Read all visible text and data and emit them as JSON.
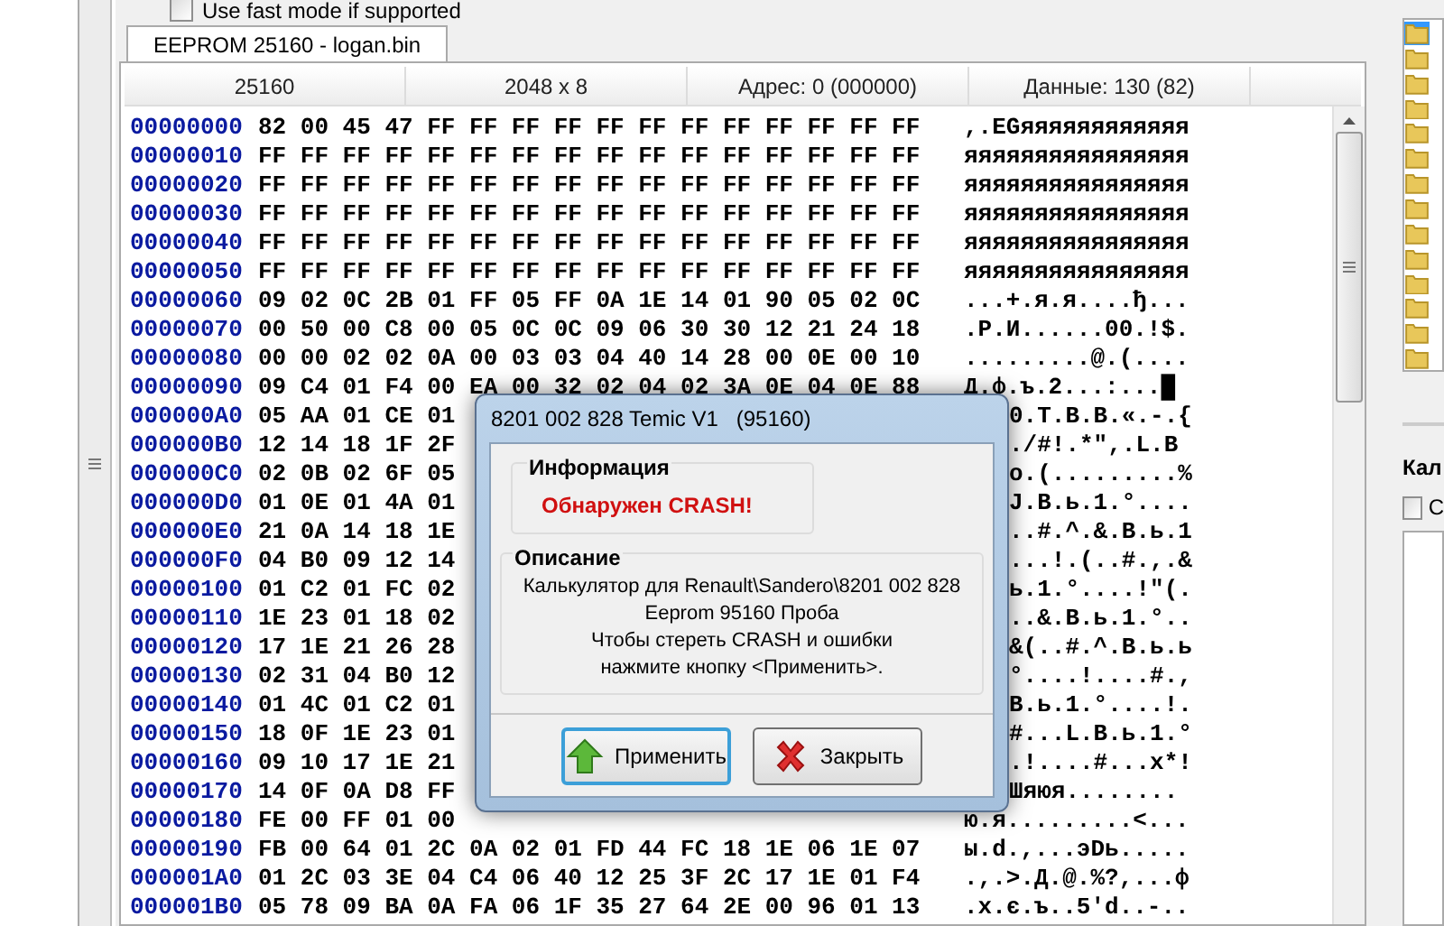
{
  "options": {
    "fast_mode": {
      "label": "Use fast mode if supported",
      "checked": false
    }
  },
  "tab": {
    "label": "EEPROM 25160 - logan.bin",
    "selected": true
  },
  "info_bar": [
    "25160",
    "2048 x 8",
    "Адрес: 0 (000000)",
    "Данные: 130 (82)"
  ],
  "hex_rows": [
    {
      "address": "00000000",
      "bytes": "82 00 45 47 FF FF FF FF FF FF FF FF FF FF FF FF",
      "ascii": ",.EGяяяяяяяяяяяя"
    },
    {
      "address": "00000010",
      "bytes": "FF FF FF FF FF FF FF FF FF FF FF FF FF FF FF FF",
      "ascii": "яяяяяяяяяяяяяяяя"
    },
    {
      "address": "00000020",
      "bytes": "FF FF FF FF FF FF FF FF FF FF FF FF FF FF FF FF",
      "ascii": "яяяяяяяяяяяяяяяя"
    },
    {
      "address": "00000030",
      "bytes": "FF FF FF FF FF FF FF FF FF FF FF FF FF FF FF FF",
      "ascii": "яяяяяяяяяяяяяяяя"
    },
    {
      "address": "00000040",
      "bytes": "FF FF FF FF FF FF FF FF FF FF FF FF FF FF FF FF",
      "ascii": "яяяяяяяяяяяяяяяя"
    },
    {
      "address": "00000050",
      "bytes": "FF FF FF FF FF FF FF FF FF FF FF FF FF FF FF FF",
      "ascii": "яяяяяяяяяяяяяяяя"
    },
    {
      "address": "00000060",
      "bytes": "09 02 0C 2B 01 FF 05 FF 0A 1E 14 01 90 05 02 0C",
      "ascii": "...+.я.я....ђ..."
    },
    {
      "address": "00000070",
      "bytes": "00 50 00 C8 00 05 0C 0C 09 06 30 30 12 21 24 18",
      "ascii": ".P.И......00.!$."
    },
    {
      "address": "00000080",
      "bytes": "00 00 02 02 0A 00 03 03 04 40 14 28 00 0E 00 10",
      "ascii": ".........@.(...."
    },
    {
      "address": "00000090",
      "bytes": "09 C4 01 F4 00 EA 00 32 02 04 02 3A 0E 04 0E 88",
      "ascii": "Д.ф.ъ.2...:...█"
    },
    {
      "address": "000000A0",
      "bytes": "05 AA 01 CE 01",
      "kind": "partly_hidden",
      "ascii": "0.T.B.B.«.-.{"
    },
    {
      "address": "000000B0",
      "bytes": "12 14 18 1F 2F",
      "kind": "partly_hidden",
      "ascii": "./#!.*\",.L.B"
    },
    {
      "address": "000000C0",
      "bytes": "02 0B 02 6F 05",
      "kind": "partly_hidden",
      "ascii": "o.(.........%"
    },
    {
      "address": "000000D0",
      "bytes": "01 0E 01 4A 01",
      "kind": "partly_hidden",
      "ascii": "J.B.ь.1.°...."
    },
    {
      "address": "000000E0",
      "bytes": "21 0A 14 18 1E",
      "kind": "partly_hidden",
      "ascii": "..#.^.&.B.ь.1"
    },
    {
      "address": "000000F0",
      "bytes": "04 B0 09 12 14",
      "kind": "partly_hidden",
      "ascii": "...!.(..#.,.&"
    },
    {
      "address": "00000100",
      "bytes": "01 C2 01 FC 02",
      "kind": "partly_hidden",
      "ascii": "ь.1.°....!\"(."
    },
    {
      "address": "00000110",
      "bytes": "1E 23 01 18 02",
      "kind": "partly_hidden",
      "ascii": "..&.B.ь.1.°.."
    },
    {
      "address": "00000120",
      "bytes": "17 1E 21 26 28",
      "kind": "partly_hidden",
      "ascii": "&(..#.^.B.ь.ь"
    },
    {
      "address": "00000130",
      "bytes": "02 31 04 B0 12",
      "kind": "partly_hidden",
      "ascii": "°....!....#.,"
    },
    {
      "address": "00000140",
      "bytes": "01 4C 01 C2 01",
      "kind": "partly_hidden",
      "ascii": "B.ь.1.°....!."
    },
    {
      "address": "00000150",
      "bytes": "18 0F 1E 23 01",
      "kind": "partly_hidden",
      "ascii": "#...L.B.ь.1.°"
    },
    {
      "address": "00000160",
      "bytes": "09 10 17 1E 21",
      "kind": "partly_hidden",
      "ascii": ".!....#...x*!"
    },
    {
      "address": "00000170",
      "bytes": "14 0F 0A D8 FF",
      "kind": "partly_hidden",
      "ascii": "Шяюя........"
    },
    {
      "address": "00000180",
      "bytes": "FE 00 FF 01 00",
      "ascii": "ю.я.........<..."
    },
    {
      "address": "00000190",
      "bytes": "FB 00 64 01 2C 0A 02 01 FD 44 FC 18 1E 06 1E 07",
      "ascii": "ы.d.,...эDь....."
    },
    {
      "address": "000001A0",
      "bytes": "01 2C 03 3E 04 C4 06 40 12 25 3F 2C 17 1E 01 F4",
      "ascii": ".,.>.Д.@.%?,...ф"
    },
    {
      "address": "000001B0",
      "bytes": "05 78 09 BA 0A FA 06 1F 35 27 64 2E 00 96 01 13",
      "ascii": ".x.є.ъ..5'd..-.."
    }
  ],
  "side_panel": {
    "label": "Кал",
    "checkbox": {
      "label": "С",
      "checked": false
    }
  },
  "dialog": {
    "title": "8201 002 828 Temic V1   (95160)",
    "info": {
      "heading": "Информация",
      "message": "Обнаружен CRASH!"
    },
    "description": {
      "heading": "Описание",
      "lines": [
        "Калькулятор для Renault\\Sandero\\8201 002 828",
        "Eeprom 95160 Проба",
        "Чтобы стереть CRASH и ошибки",
        "нажмите кнопку <Применить>."
      ]
    },
    "buttons": [
      {
        "kind": "apply",
        "label": "Применить",
        "selected": true
      },
      {
        "kind": "close",
        "label": "Закрыть",
        "selected": false
      }
    ]
  }
}
